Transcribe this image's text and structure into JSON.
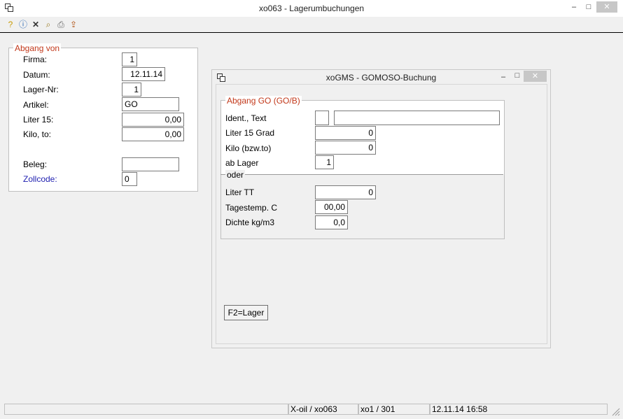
{
  "window": {
    "title": "xo063 - Lagerumbuchungen",
    "minimize": "–",
    "maximize": "□",
    "close": "✕"
  },
  "toolbar": {
    "icons": [
      "help-icon",
      "info-icon",
      "delete-icon",
      "search-icon",
      "print-icon",
      "export-icon"
    ]
  },
  "abgang": {
    "legend": "Abgang von",
    "fields": {
      "firma_label": "Firma:",
      "firma_value": "1",
      "datum_label": "Datum:",
      "datum_value": "12.11.14",
      "lager_label": "Lager-Nr:",
      "lager_value": "1",
      "artikel_label": "Artikel:",
      "artikel_value": "GO",
      "liter_label": "Liter 15:",
      "liter_value": "0,00",
      "kilo_label": "Kilo, to:",
      "kilo_value": "0,00",
      "beleg_label": "Beleg:",
      "beleg_value": "",
      "zoll_label": "Zollcode:",
      "zoll_value": "0"
    },
    "zoll_color": "#1f1fb0"
  },
  "dialog": {
    "title": "xoGMS - GOMOSO-Buchung",
    "minimize": "–",
    "maximize": "□",
    "close": "✕",
    "group_legend": "Abgang GO (GO/B)",
    "ident_label": "Ident., Text",
    "ident_code": "",
    "ident_text": "",
    "liter15_label": "Liter 15 Grad",
    "liter15_value": "0",
    "kilo_label": "Kilo (bzw.to)",
    "kilo_value": "0",
    "lager_label": "ab Lager",
    "lager_value": "1",
    "oder_label": "oder",
    "litertt_label": "Liter TT",
    "litertt_value": "0",
    "temp_label": "Tagestemp. C",
    "temp_value": "00,00",
    "dichte_label": "Dichte kg/m3",
    "dichte_value": "0,0",
    "f2_button": "F2=Lager"
  },
  "status": {
    "cell1": "",
    "cell2": "X-oil / xo063",
    "cell3": "xo1 / 301",
    "cell4": "12.11.14 16:58"
  }
}
